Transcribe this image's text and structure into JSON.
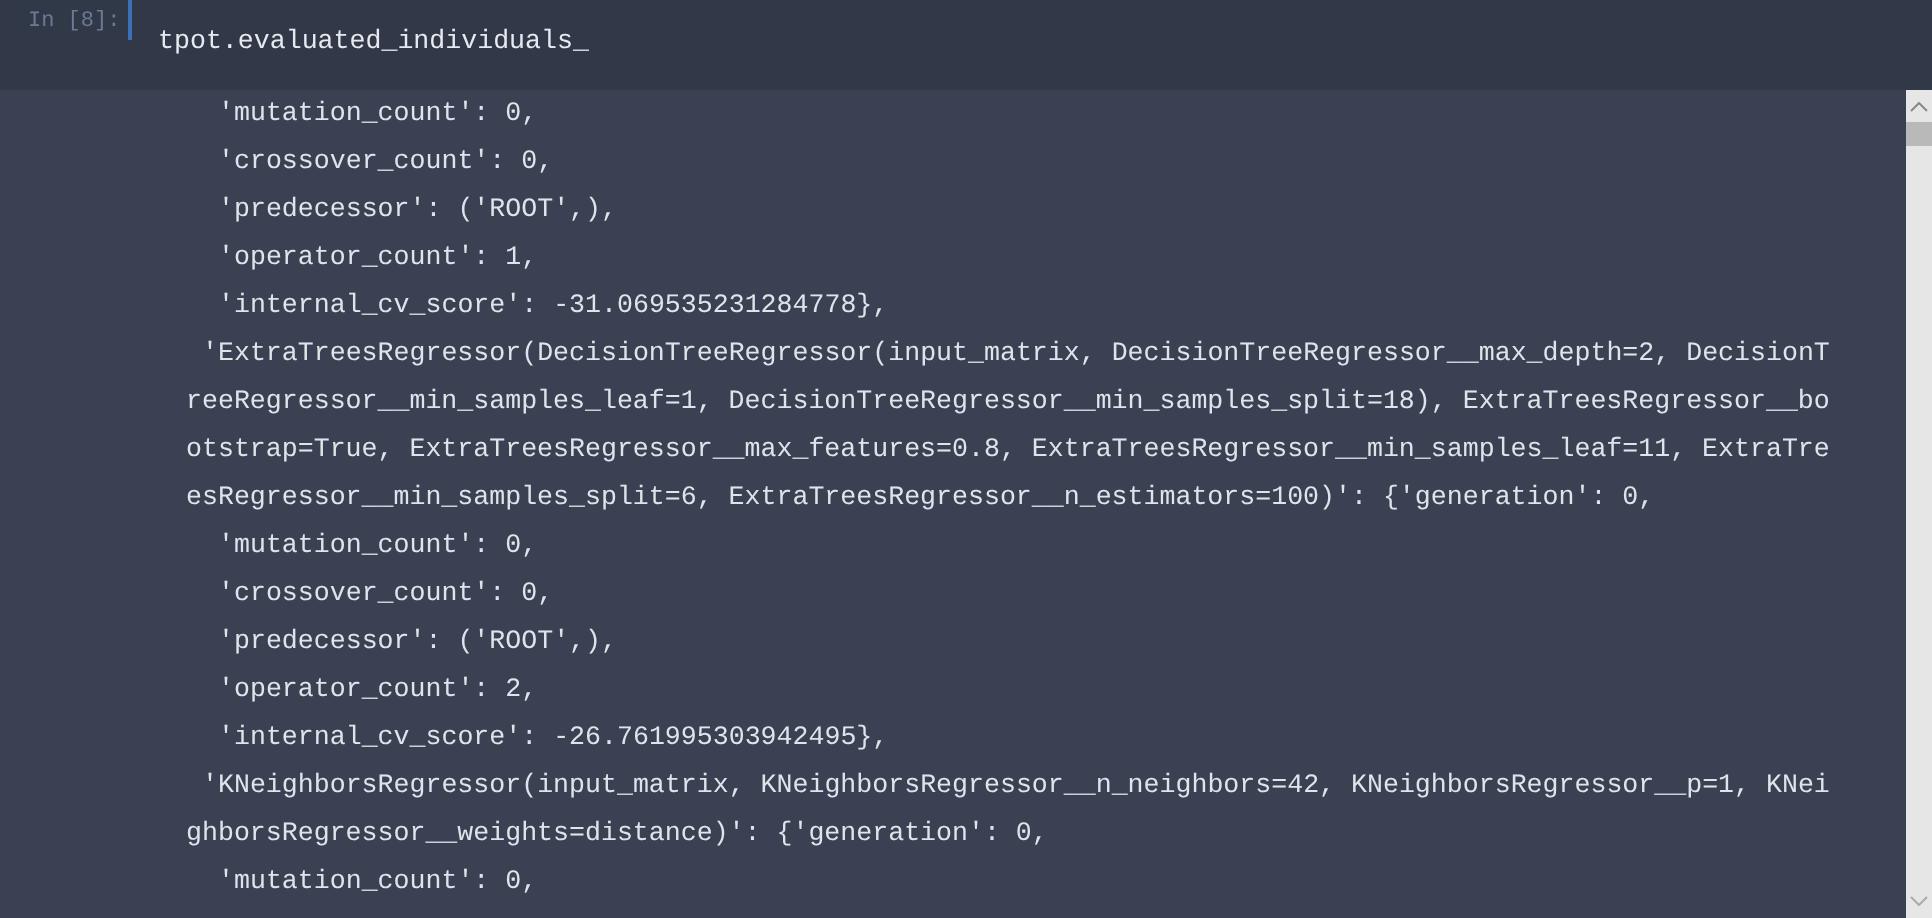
{
  "cell": {
    "prompt": "In [8]:",
    "code": "tpot.evaluated_individuals_"
  },
  "output": {
    "lines": [
      {
        "kind": "entry",
        "text": "'mutation_count': 0,"
      },
      {
        "kind": "entry",
        "text": "'crossover_count': 0,"
      },
      {
        "kind": "entry",
        "text": "'predecessor': ('ROOT',),"
      },
      {
        "kind": "entry",
        "text": "'operator_count': 1,"
      },
      {
        "kind": "entry",
        "text": "'internal_cv_score': -31.069535231284778},"
      },
      {
        "kind": "head",
        "text": "'ExtraTreesRegressor(DecisionTreeRegressor(input_matrix, DecisionTreeRegressor__max_depth=2, DecisionT"
      },
      {
        "kind": "wrap",
        "text": "reeRegressor__min_samples_leaf=1, DecisionTreeRegressor__min_samples_split=18), ExtraTreesRegressor__bo"
      },
      {
        "kind": "wrap",
        "text": "otstrap=True, ExtraTreesRegressor__max_features=0.8, ExtraTreesRegressor__min_samples_leaf=11, ExtraTre"
      },
      {
        "kind": "wrap",
        "text": "esRegressor__min_samples_split=6, ExtraTreesRegressor__n_estimators=100)': {'generation': 0,"
      },
      {
        "kind": "entry",
        "text": "'mutation_count': 0,"
      },
      {
        "kind": "entry",
        "text": "'crossover_count': 0,"
      },
      {
        "kind": "entry",
        "text": "'predecessor': ('ROOT',),"
      },
      {
        "kind": "entry",
        "text": "'operator_count': 2,"
      },
      {
        "kind": "entry",
        "text": "'internal_cv_score': -26.761995303942495},"
      },
      {
        "kind": "head",
        "text": "'KNeighborsRegressor(input_matrix, KNeighborsRegressor__n_neighbors=42, KNeighborsRegressor__p=1, KNei"
      },
      {
        "kind": "wrap",
        "text": "ghborsRegressor__weights=distance)': {'generation': 0,"
      },
      {
        "kind": "entry",
        "text": "'mutation_count': 0,"
      }
    ]
  }
}
